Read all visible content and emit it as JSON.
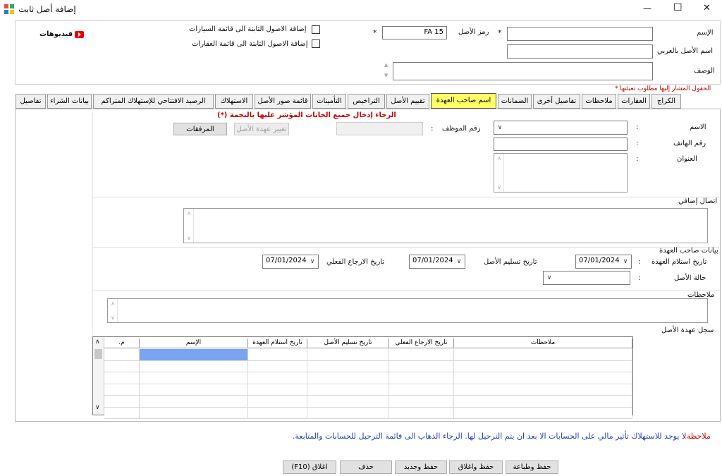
{
  "window": {
    "title": "إضافة أصل ثابت",
    "controls": {
      "minimize": "—",
      "maximize": "☐",
      "close": "✕"
    }
  },
  "header": {
    "name_label": "الإسم",
    "name_value": "",
    "arabic_name_label": "اسم الأصل بالعربي",
    "arabic_name_value": "",
    "description_label": "الوصف",
    "description_value": "",
    "asset_code_label": "رمز الأصل",
    "asset_code_value": "FA 15",
    "required_star": "*",
    "add_to_cars_label": "إضافة الاصول الثابتة الى قائمة السيارات",
    "add_to_realestate_label": "إضافة الاصول الثابتة الى قائمة العقارات",
    "videos_label": "فيديوهات",
    "required_note": "الحقول المشار إليها مطلوب تعبئتها *"
  },
  "tabs": [
    {
      "label": "الكراج"
    },
    {
      "label": "العقارات"
    },
    {
      "label": "ملاحظات"
    },
    {
      "label": "تفاصيل أخرى"
    },
    {
      "label": "الضمانات"
    },
    {
      "label": "اسم صاحب العهدة"
    },
    {
      "label": "تقييم الأصل"
    },
    {
      "label": "التراخيص"
    },
    {
      "label": "التأمينات"
    },
    {
      "label": "قائمة صور الأصل"
    },
    {
      "label": "الاستهلاك"
    },
    {
      "label": "الرصيد الافتتاحي للإستهلاك المتراكم"
    },
    {
      "label": "بيانات الشراء"
    },
    {
      "label": "تفاصيل"
    }
  ],
  "custody": {
    "warning": "الرجاء إدخال جميع الخانات المؤشر عليها بالنجمة (*)",
    "name_label": "الاسم",
    "colon": ":",
    "phone_label": "رقم الهاتف",
    "address_label": "العنوان",
    "employee_no_label": "رقم الموظف",
    "change_custody_button": "تغيير عهدة الأصل",
    "attachments_button": "المرفقات",
    "extra_contact_label": "اتصال إضافي",
    "holder_data_label": "بيانات صاحب العهدة",
    "receive_date_label": "تاريخ استلام العهدة",
    "receive_date_value": "07/01/2024",
    "delivery_date_label": "تاريخ تسليم الأصل",
    "delivery_date_value": "07/01/2024",
    "actual_return_label": "تاريخ الارجاع الفعلي",
    "actual_return_value": "07/01/2024",
    "asset_status_label": "حالة الأصل",
    "notes_label": "ملاحظات",
    "log_label": "سجل عهدة الأصل"
  },
  "grid": {
    "columns": [
      "م.",
      "الإسم",
      "تاريخ استلام العهدة",
      "تاريخ تسليم الأصل",
      "تاريخ الارجاع الفعلي",
      "ملاحظات"
    ]
  },
  "footer": {
    "note_label": "ملاحظة:",
    "note_text": "لا يوجد للاستهلاك تأثير مالي على الحسابات الا بعد ان يتم الترحيل لها. الرجاء الذهاب الى قائمة الترحيل للحسابات والمتابعة.",
    "buttons": {
      "save_print": "حفظ وطباعة",
      "save_close": "حفظ واغلاق",
      "save_new": "حفظ وجديد",
      "delete": "حذف",
      "close": "اغلاق (F10)"
    }
  },
  "colors": {
    "active_tab": "#ffff66",
    "required_red": "#cc0000",
    "note_blue": "#1f3fbf",
    "selected_cell": "#7aa4f0"
  }
}
